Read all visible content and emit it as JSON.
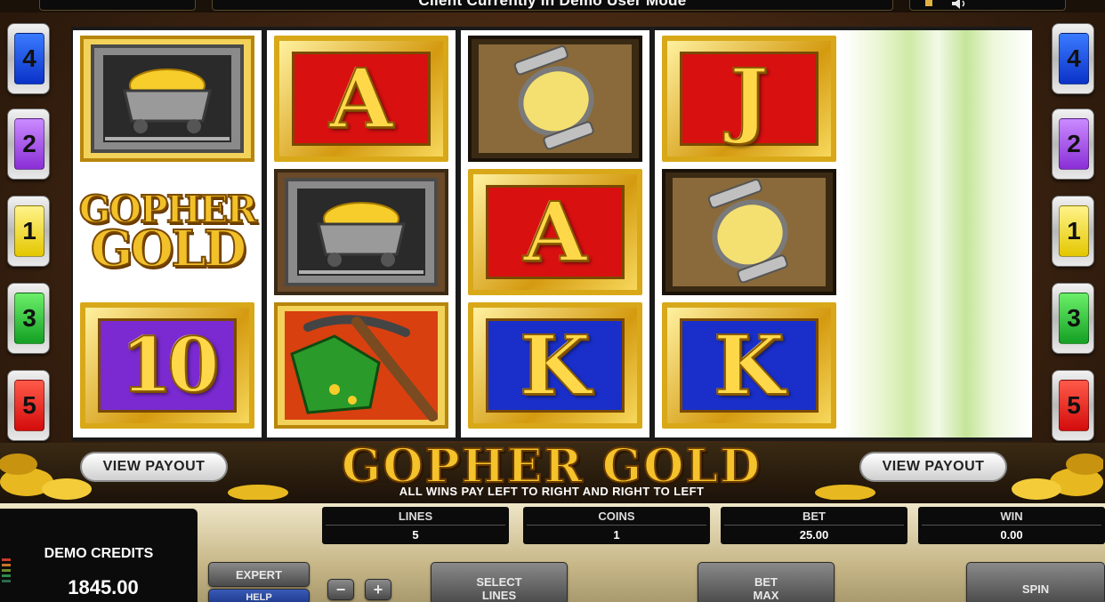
{
  "top_bar": {
    "message": "Client Currently In Demo User Mode"
  },
  "payline_buttons": {
    "left": [
      "4",
      "2",
      "1",
      "3",
      "5"
    ],
    "right": [
      "4",
      "2",
      "1",
      "3",
      "5"
    ]
  },
  "reels": [
    [
      "gold-cart",
      "gopher-gold-logo",
      "ten"
    ],
    [
      "ace",
      "gold-cart",
      "pickaxe"
    ],
    [
      "lantern",
      "ace",
      "king"
    ],
    [
      "jack",
      "lantern",
      "king"
    ],
    [
      "spinning",
      "spinning",
      "spinning"
    ]
  ],
  "symbols": {
    "ace": "A",
    "king": "K",
    "jack": "J",
    "ten": "10",
    "logo_top": "GOPHER",
    "logo_bottom": "GOLD"
  },
  "banner": {
    "title": "GOPHER GOLD",
    "subtitle": "ALL WINS PAY LEFT TO RIGHT AND RIGHT TO LEFT",
    "view_payout_left": "VIEW PAYOUT",
    "view_payout_right": "VIEW PAYOUT"
  },
  "credits": {
    "label": "DEMO CREDITS",
    "value": "1845.00"
  },
  "info": {
    "lines_label": "LINES",
    "lines_value": "5",
    "coins_label": "COINS",
    "coins_value": "1",
    "bet_label": "BET",
    "bet_value": "25.00",
    "win_label": "WIN",
    "win_value": "0.00"
  },
  "controls": {
    "expert": "EXPERT",
    "help": "HELP",
    "minus": "−",
    "plus": "+",
    "select_lines_1": "SELECT",
    "select_lines_2": "LINES",
    "bet_max_1": "BET",
    "bet_max_2": "MAX",
    "spin": "SPIN"
  },
  "colors": {
    "line_1": "#e4c700",
    "line_2": "#8a2ed6",
    "line_3": "#14a024",
    "line_4": "#0b32c8",
    "line_5": "#d30c0c",
    "gold": "#f4c22a"
  }
}
